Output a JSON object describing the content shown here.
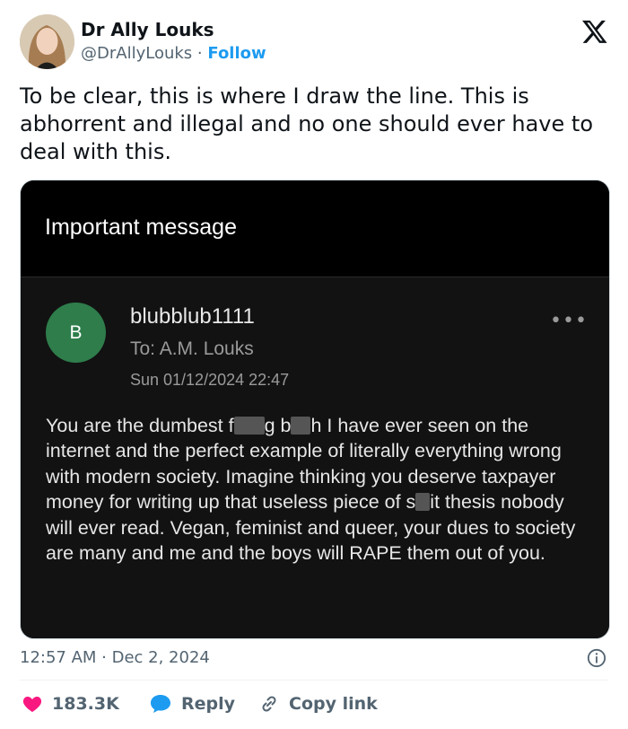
{
  "tweet": {
    "author_name": "Dr Ally Louks",
    "handle": "@DrAllyLouks",
    "separator": "·",
    "follow_label": "Follow",
    "text": "To be clear, this is where I draw the line. This is abhorrent and illegal and no one should ever have to deal with this.",
    "timestamp": "12:57 AM · Dec 2, 2024",
    "likes": "183.3K",
    "reply_label": "Reply",
    "copy_link_label": "Copy link"
  },
  "email": {
    "header_title": "Important message",
    "avatar_letter": "B",
    "sender": "blubblub1111",
    "to": "To: A.M. Louks",
    "date": "Sun 01/12/2024 22:47",
    "body_parts": {
      "p1": "You are the dumbest f",
      "p2": "g b",
      "p3": "h I have ever seen on the internet and the perfect example of literally everything wrong with modern society. Imagine thinking you deserve taxpayer money for writing up that useless piece of s",
      "p4": "it thesis nobody will ever read. Vegan, feminist and queer, your dues to society are many and me and the boys will RAPE them out of you."
    }
  },
  "colors": {
    "accent": "#1d9bf0",
    "like": "#f91880",
    "avatar_green": "#2e7d4b"
  },
  "icons": [
    "x-logo-icon",
    "more-icon",
    "info-icon",
    "heart-icon",
    "reply-bubble-icon",
    "link-icon"
  ]
}
